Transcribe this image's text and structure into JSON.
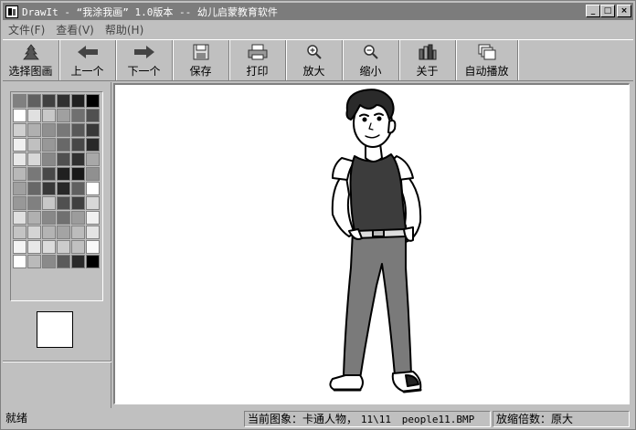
{
  "window": {
    "title": "DrawIt - “我涂我画” 1.0版本 -- 幼儿启蒙教育软件",
    "title_buttons": [
      "minimize",
      "maximize",
      "close"
    ]
  },
  "menu": [
    {
      "label": "文件(F)"
    },
    {
      "label": "查看(V)"
    },
    {
      "label": "帮助(H)"
    }
  ],
  "toolbar": [
    {
      "label": "选择图画",
      "icon": "select-picture-icon"
    },
    {
      "label": "上一个",
      "icon": "arrow-left-icon"
    },
    {
      "label": "下一个",
      "icon": "arrow-right-icon"
    },
    {
      "label": "保存",
      "icon": "save-disk-icon"
    },
    {
      "label": "打印",
      "icon": "printer-icon"
    },
    {
      "label": "放大",
      "icon": "zoom-in-icon"
    },
    {
      "label": "缩小",
      "icon": "zoom-out-icon"
    },
    {
      "label": "关于",
      "icon": "about-icon"
    },
    {
      "label": "自动播放",
      "icon": "auto-play-icon"
    }
  ],
  "palette": {
    "colors": [
      "#808080",
      "#606060",
      "#404040",
      "#303030",
      "#202020",
      "#000000",
      "#ffffff",
      "#e0e0e0",
      "#c8c8c8",
      "#a0a0a0",
      "#707070",
      "#505050",
      "#d0d0d0",
      "#b0b0b0",
      "#909090",
      "#787878",
      "#585858",
      "#383838",
      "#f0f0f0",
      "#c0c0c0",
      "#989898",
      "#686868",
      "#484848",
      "#282828",
      "#e8e8e8",
      "#d8d8d8",
      "#888888",
      "#505050",
      "#303030",
      "#a8a8a8",
      "#b8b8b8",
      "#787878",
      "#484848",
      "#202020",
      "#181818",
      "#909090",
      "#a0a0a0",
      "#686868",
      "#383838",
      "#282828",
      "#606060",
      "#ffffff",
      "#989898",
      "#808080",
      "#c8c8c8",
      "#505050",
      "#404040",
      "#d8d8d8",
      "#e0e0e0",
      "#b0b0b0",
      "#888888",
      "#707070",
      "#9c9c9c",
      "#f0f0f0",
      "#c4c4c4",
      "#d4d4d4",
      "#b4b4b4",
      "#a4a4a4",
      "#bcbcbc",
      "#e4e4e4",
      "#f4f4f4",
      "#e8e8e8",
      "#dcdcdc",
      "#cccccc",
      "#c0c0c0",
      "#f8f8f8",
      "#ffffff",
      "#bababa",
      "#8a8a8a",
      "#5a5a5a",
      "#2a2a2a",
      "#000000"
    ],
    "current_color": "#ffffff"
  },
  "status": {
    "ready": "就绪",
    "current_image_label": "当前图象：卡通人物，",
    "current_image_index": "11\\11",
    "current_image_file": "people11.BMP",
    "zoom": "放缩倍数：原大"
  }
}
